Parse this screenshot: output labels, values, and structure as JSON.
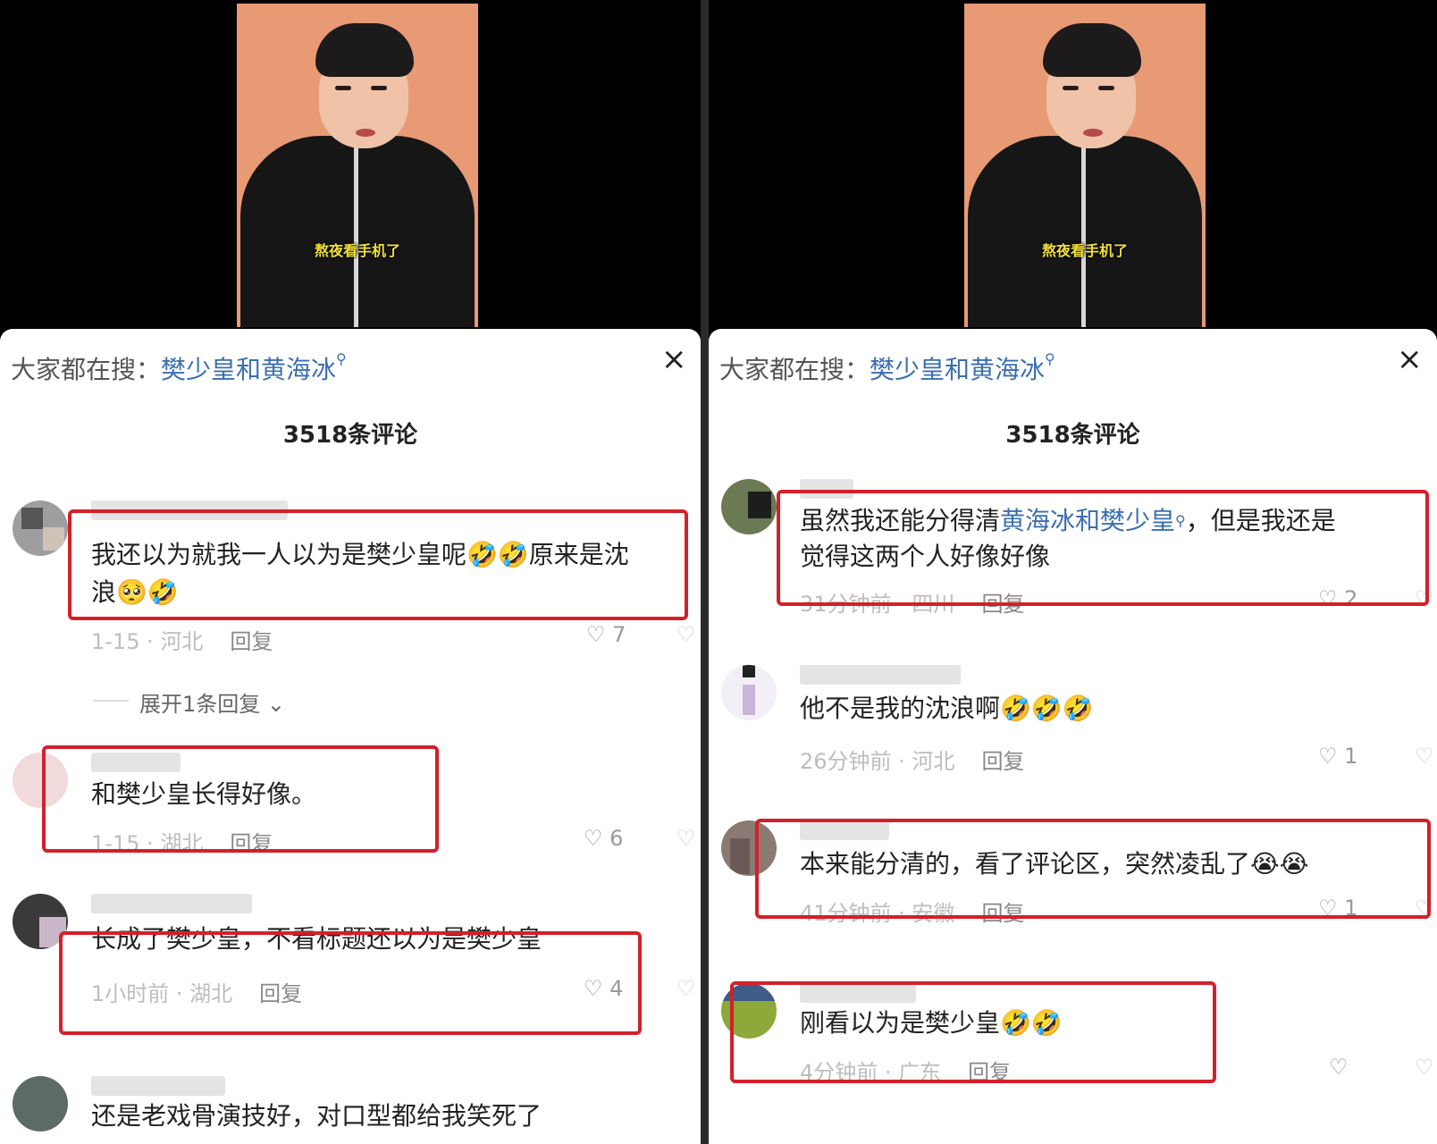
{
  "left": {
    "video_caption": "熬夜看手机了",
    "search_prefix": "大家都在搜：",
    "search_term": "樊少皇和黄海冰",
    "search_icon": "magnifier-icon",
    "close_icon": "×",
    "comment_count": "3518条评论",
    "comments": [
      {
        "text_line1": "我还以为就我一人以为是樊少皇呢🤣🤣原来是沈",
        "text_line2": "浪🥺🤣",
        "time": "1-15 · 河北",
        "reply": "回复",
        "likes": "7"
      },
      {
        "text_line1": "和樊少皇长得好像。",
        "time": "1-15 · 湖北",
        "reply": "回复",
        "likes": "6"
      },
      {
        "text_line1": "长成了樊少皇，不看标题还以为是樊少皇",
        "time": "1小时前 · 湖北",
        "reply": "回复",
        "likes": "4"
      },
      {
        "text_line1": "还是老戏骨演技好，对口型都给我笑死了"
      }
    ],
    "expand": "展开1条回复"
  },
  "right": {
    "video_caption": "熬夜看手机了",
    "search_prefix": "大家都在搜：",
    "search_term": "樊少皇和黄海冰",
    "close_icon": "×",
    "comment_count": "3518条评论",
    "comments": [
      {
        "text_pre": "虽然我还能分得清",
        "text_link": "黄海冰和樊少皇",
        "text_post": "，但是我还是",
        "text_line2": "觉得这两个人好像好像",
        "time": "31分钟前 · 四川",
        "reply": "回复",
        "likes": "2"
      },
      {
        "text_line1": "他不是我的沈浪啊🤣🤣🤣",
        "time": "26分钟前 · 河北",
        "reply": "回复",
        "likes": "1"
      },
      {
        "text_line1": "本来能分清的，看了评论区，突然凌乱了😭😭",
        "time": "41分钟前 · 安徽",
        "reply": "回复",
        "likes": "1"
      },
      {
        "text_line1": "刚看以为是樊少皇🤣🤣",
        "time": "4分钟前 · 广东",
        "reply": "回复",
        "likes": ""
      }
    ]
  },
  "colors": {
    "highlight_box": "#d3202a",
    "link": "#3b6fb0",
    "video_bg": "#e89a74"
  }
}
